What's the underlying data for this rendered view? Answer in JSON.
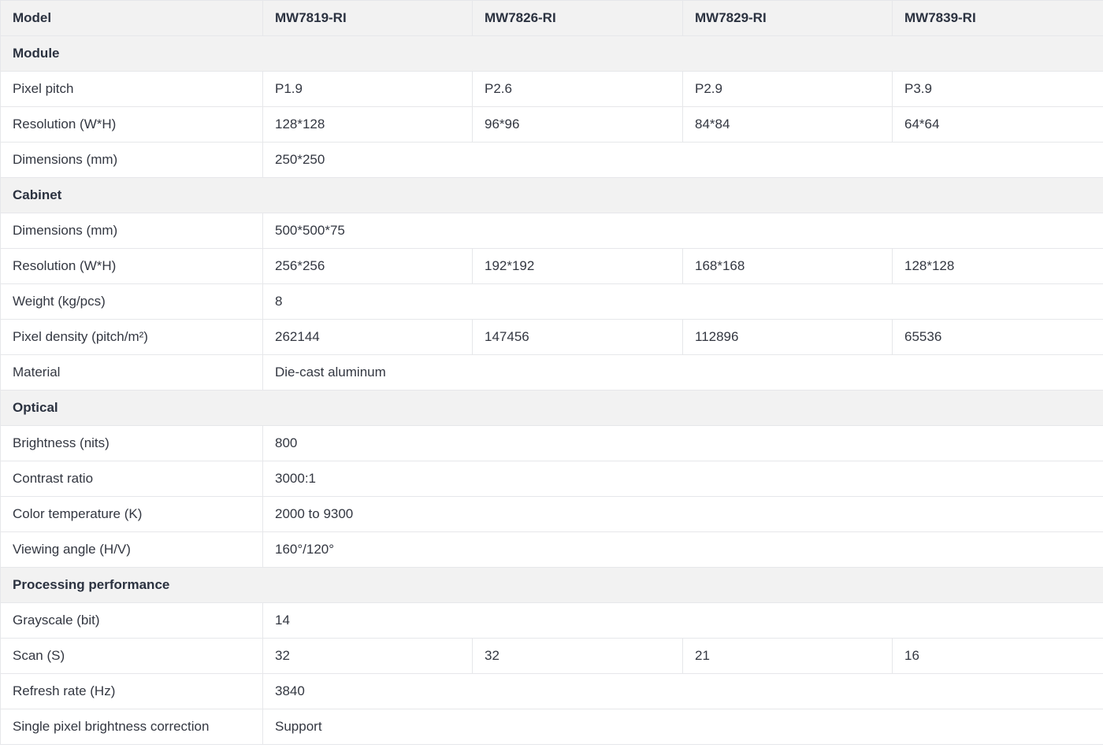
{
  "header": {
    "label": "Model",
    "models": [
      "MW7819-RI",
      "MW7826-RI",
      "MW7829-RI",
      "MW7839-RI"
    ]
  },
  "sections": {
    "module": {
      "title": "Module",
      "pixel_pitch": {
        "label": "Pixel pitch",
        "values": [
          "P1.9",
          "P2.6",
          "P2.9",
          "P3.9"
        ]
      },
      "resolution": {
        "label": "Resolution (W*H)",
        "values": [
          "128*128",
          "96*96",
          "84*84",
          "64*64"
        ]
      },
      "dimensions": {
        "label": "Dimensions (mm)",
        "value": "250*250"
      }
    },
    "cabinet": {
      "title": "Cabinet",
      "dimensions": {
        "label": "Dimensions (mm)",
        "value": "500*500*75"
      },
      "resolution": {
        "label": "Resolution (W*H)",
        "values": [
          "256*256",
          "192*192",
          "168*168",
          "128*128"
        ]
      },
      "weight": {
        "label": "Weight (kg/pcs)",
        "value": "8"
      },
      "pixel_density": {
        "label": "Pixel density (pitch/m²)",
        "values": [
          "262144",
          "147456",
          "112896",
          "65536"
        ]
      },
      "material": {
        "label": "Material",
        "value": "Die-cast aluminum"
      }
    },
    "optical": {
      "title": "Optical",
      "brightness": {
        "label": "Brightness (nits)",
        "value": "800"
      },
      "contrast": {
        "label": "Contrast ratio",
        "value": "3000:1"
      },
      "color_temperature": {
        "label": "Color temperature (K)",
        "value": "2000 to 9300"
      },
      "viewing_angle": {
        "label": "Viewing angle (H/V)",
        "value": "160°/120°"
      }
    },
    "processing": {
      "title": "Processing performance",
      "grayscale": {
        "label": "Grayscale (bit)",
        "value": "14"
      },
      "scan": {
        "label": "Scan (S)",
        "values": [
          "32",
          "32",
          "21",
          "16"
        ]
      },
      "refresh_rate": {
        "label": "Refresh rate (Hz)",
        "value": "3840"
      },
      "brightness_correction": {
        "label": "Single pixel brightness correction",
        "value": "Support"
      }
    }
  }
}
